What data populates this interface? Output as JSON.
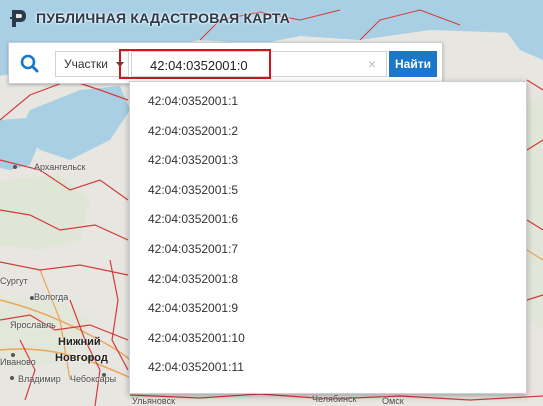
{
  "header": {
    "title": "ПУБЛИЧНАЯ КАДАСТРОВАЯ КАРТА"
  },
  "search": {
    "type_selected": "Участки",
    "query": "42:04:0352001:0",
    "clear_glyph": "×",
    "find_label": "Найти"
  },
  "suggestions": [
    "42:04:0352001:1",
    "42:04:0352001:2",
    "42:04:0352001:3",
    "42:04:0352001:5",
    "42:04:0352001:6",
    "42:04:0352001:7",
    "42:04:0352001:8",
    "42:04:0352001:9",
    "42:04:0352001:10",
    "42:04:0352001:11"
  ],
  "map": {
    "labels": {
      "arkhangelsk": "Архангельск",
      "surgut": "Сургут",
      "vologda": "Вологда",
      "yaroslavl": "Ярославль",
      "nizhny": "Нижний",
      "novgorod": "Новгород",
      "ivanovo": "Иваново",
      "vladimir": "Владимир",
      "cheboksary": "Чебоксары",
      "ulyanovsk": "Ульяновск",
      "chelyabinsk": "Челябинск",
      "omsk": "Омск"
    }
  },
  "colors": {
    "accent": "#1a77c9",
    "highlight": "#d0161b",
    "water": "#a9cfe4",
    "land": "#e8e6e1",
    "boundary": "#d43b3b"
  },
  "icons": {
    "search": "search-icon",
    "logo": "logo-icon",
    "clear": "clear-icon",
    "caret": "chevron-down-icon"
  }
}
